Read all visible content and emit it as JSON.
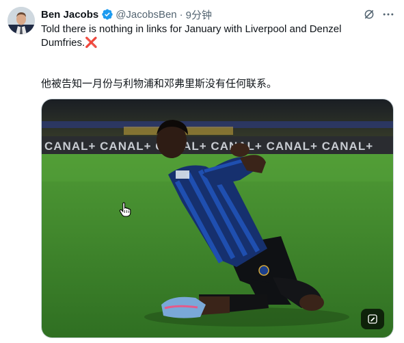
{
  "tweet": {
    "author": {
      "display_name": "Ben Jacobs",
      "handle": "@JacobsBen",
      "verified": true
    },
    "separator": "·",
    "time": "9分钟",
    "text": "Told there is nothing in links for January with Liverpool and Denzel Dumfries.",
    "emoji": "❌",
    "translation": "他被告知一月份与利物浦和邓弗里斯没有任何联系。"
  },
  "media": {
    "billboard_text": "CANAL+ CANAL+ CANAL+ CANAL+ CANAL+ CANAL+"
  },
  "colors": {
    "verified": "#1d9bf0",
    "text_primary": "#0f1419",
    "text_secondary": "#536471",
    "pitch": "#3f8a2e",
    "inter_blue": "#1f4fb0"
  },
  "icons": {
    "verified": "verified-badge-icon",
    "grok": "grok-icon",
    "more": "more-icon",
    "media_badge": "image-edit-icon"
  }
}
